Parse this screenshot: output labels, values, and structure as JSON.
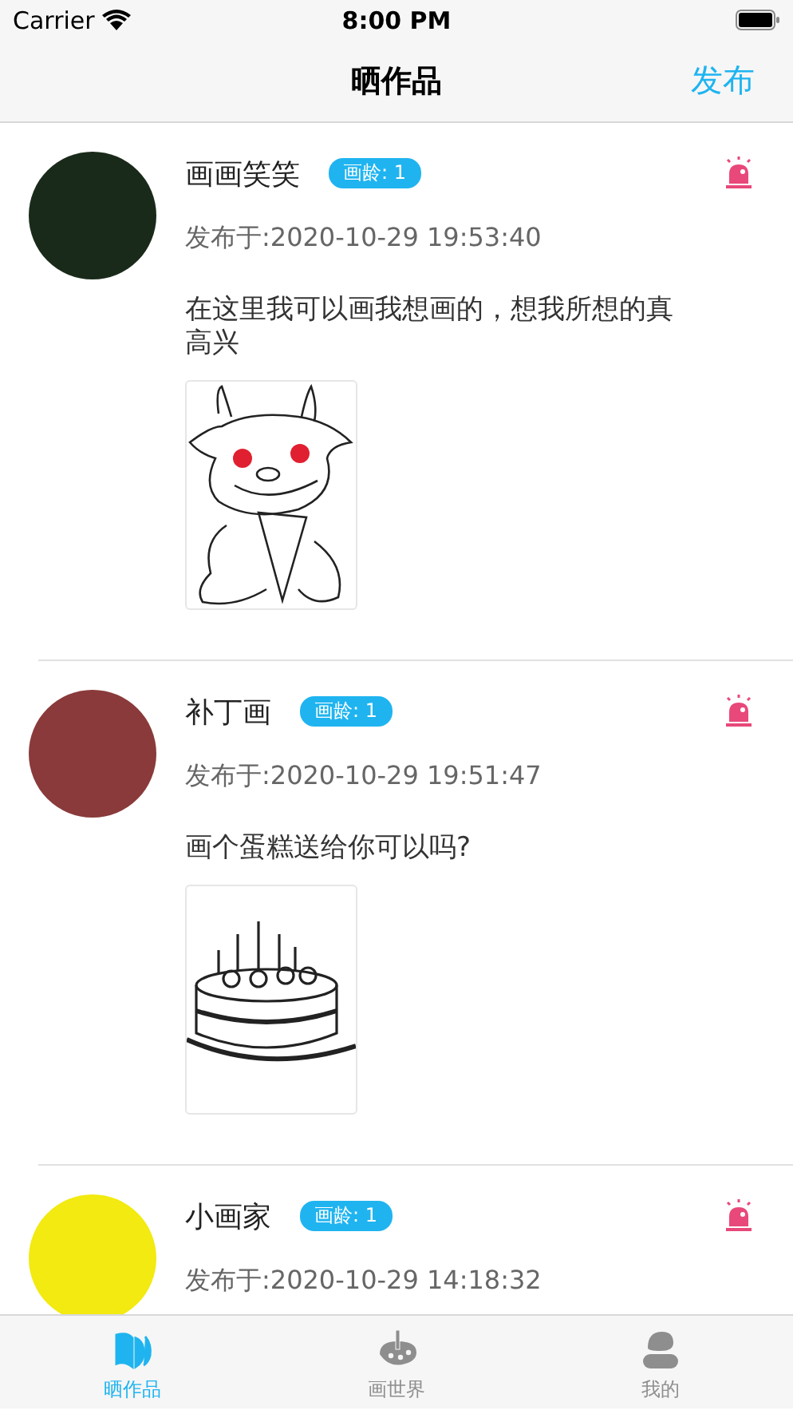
{
  "status_bar": {
    "carrier": "Carrier",
    "time": "8:00 PM"
  },
  "nav": {
    "title": "晒作品",
    "action": "发布"
  },
  "posts": [
    {
      "author": "画画笑笑",
      "badge": "画龄: 1",
      "date": "发布于:2020-10-29 19:53:40",
      "text": "在这里我可以画我想画的，想我所想的真高兴"
    },
    {
      "author": "补丁画",
      "badge": "画龄: 1",
      "date": "发布于:2020-10-29 19:51:47",
      "text": "画个蛋糕送给你可以吗?"
    },
    {
      "author": "小画家",
      "badge": "画龄: 1",
      "date": "发布于:2020-10-29 14:18:32"
    }
  ],
  "tabs": [
    {
      "label": "晒作品",
      "selected": true
    },
    {
      "label": "画世界",
      "selected": false
    },
    {
      "label": "我的",
      "selected": false
    }
  ]
}
